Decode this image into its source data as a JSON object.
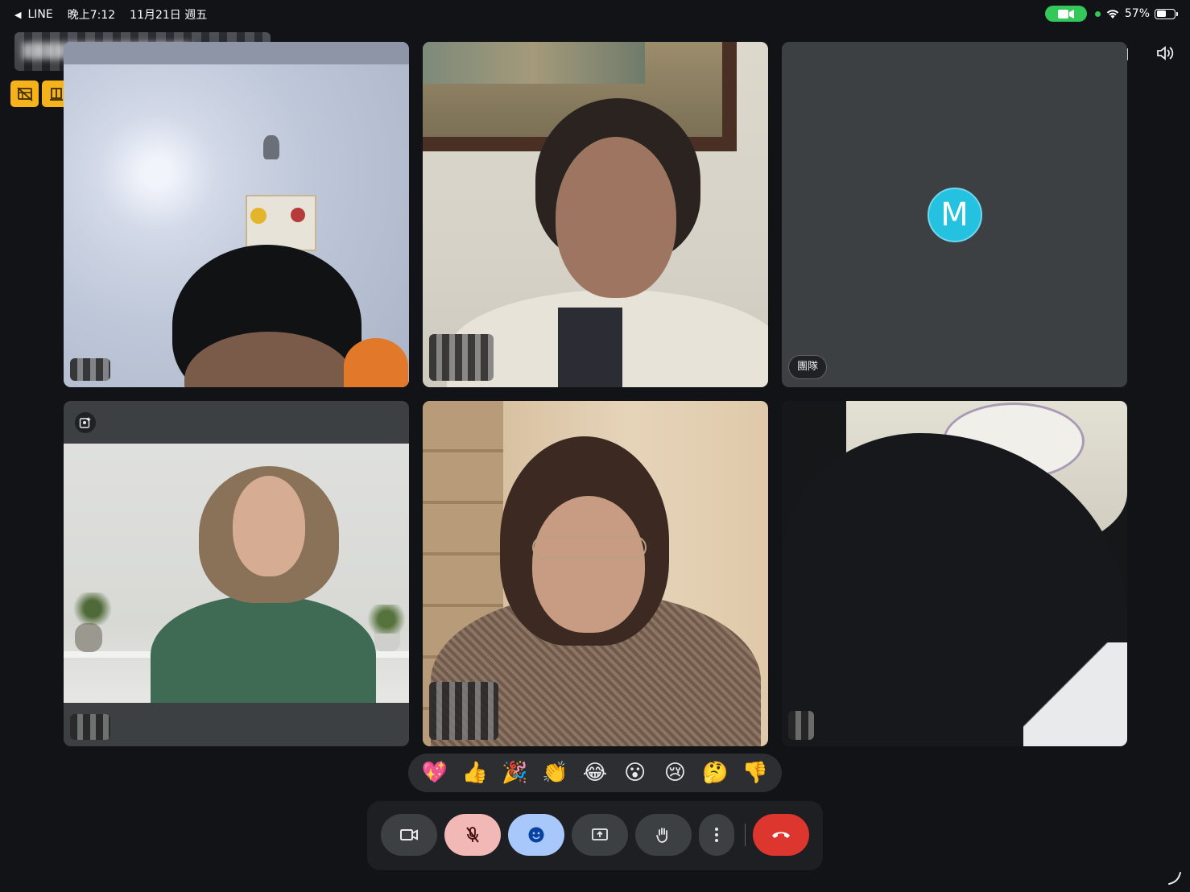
{
  "status_bar": {
    "back_app": "LINE",
    "time": "晚上7:12",
    "date": "11月21日 週五",
    "battery": "57%"
  },
  "tiles": [
    {
      "id": "tile-1",
      "name_label": ""
    },
    {
      "id": "tile-2",
      "name_label": ""
    },
    {
      "id": "tile-3",
      "avatar_letter": "M",
      "name_label": "團隊"
    },
    {
      "id": "tile-4",
      "name_label": ""
    },
    {
      "id": "tile-5",
      "name_label": ""
    },
    {
      "id": "tile-6",
      "name_label": ""
    }
  ],
  "reactions": [
    "💖",
    "👍",
    "🎉",
    "👏",
    "😂",
    "😮",
    "😢",
    "🤔",
    "👎"
  ],
  "colors": {
    "background": "#121316",
    "tile": "#3c4043",
    "avatar": "#24c1e0",
    "mic_off": "#f2b8b5",
    "emoji_active": "#a8c7fa",
    "end_call": "#dc362e",
    "status_yellow": "#f6b21b",
    "recording_red": "#ee675c"
  },
  "icons": {
    "status": [
      "no-video-layout-icon",
      "companion-mode-icon",
      "recording-icon"
    ],
    "top_right": [
      "switch-camera-icon",
      "speaker-icon"
    ],
    "controls": [
      "camera-icon",
      "mic-off-icon",
      "emoji-icon",
      "present-screen-icon",
      "raise-hand-icon",
      "more-options-icon",
      "end-call-icon"
    ]
  }
}
